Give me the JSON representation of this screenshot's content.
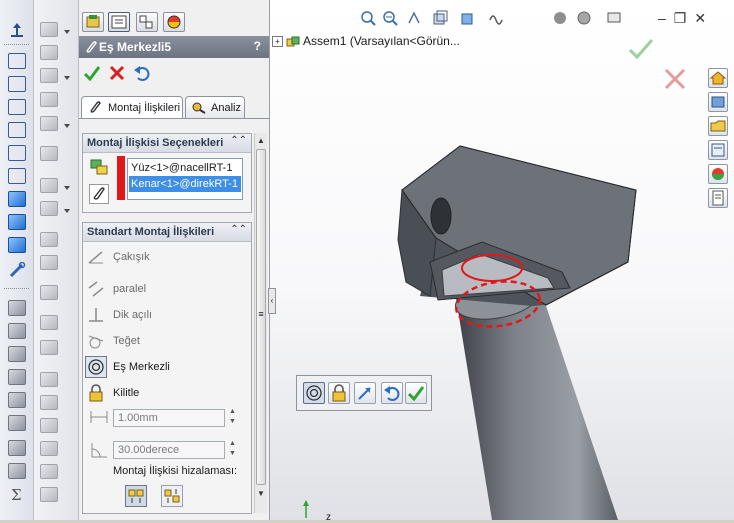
{
  "property_manager": {
    "title": "Eş Merkezli5",
    "help": "?",
    "ok_icon": "check-icon",
    "cancel_icon": "x-icon",
    "pushpin_icon": "undo-arrow-icon",
    "tabs": [
      {
        "label": "Montaj İlişkileri",
        "icon": "paperclip-icon",
        "active": true
      },
      {
        "label": "Analiz",
        "icon": "analysis-icon",
        "active": false
      }
    ],
    "selections_group": {
      "header": "Montaj İlişkisi Seçenekleri",
      "items": [
        "Yüz<1>@nacellRT-1",
        "Kenar<1>@direkRT-1"
      ],
      "selected_index": 1
    },
    "standard_group": {
      "header": "Standart Montaj İlişkileri",
      "mates": [
        {
          "label": "Çakışık",
          "icon": "coincident-icon",
          "enabled": false
        },
        {
          "label": "paralel",
          "icon": "parallel-icon",
          "enabled": false
        },
        {
          "label": "Dik açılı",
          "icon": "perpendicular-icon",
          "enabled": false
        },
        {
          "label": "Teğet",
          "icon": "tangent-icon",
          "enabled": false
        },
        {
          "label": "Eş Merkezli",
          "icon": "concentric-icon",
          "enabled": true,
          "active": true
        },
        {
          "label": "Kilitle",
          "icon": "lock-icon",
          "enabled": true
        }
      ],
      "distance_value": "1.00mm",
      "angle_value": "30.00derece",
      "alignment_label": "Montaj İlişkisi hizalaması:"
    }
  },
  "feature_tree": {
    "root": "Assem1  (Varsayılan<Görün..."
  },
  "triad_label": "z",
  "colors": {
    "accent_blue": "#3d8ee6",
    "selection_red": "#e01818",
    "ok_green": "#2fa52f",
    "cancel_red": "#d82020",
    "part_gray": "#6f737a"
  }
}
